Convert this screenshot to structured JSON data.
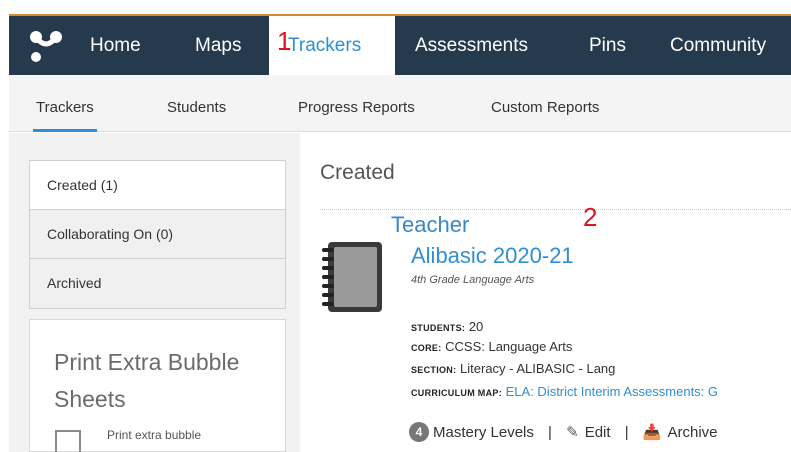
{
  "nav": {
    "items": [
      {
        "label": "Home"
      },
      {
        "label": "Maps"
      },
      {
        "label": "Trackers"
      },
      {
        "label": "Assessments"
      },
      {
        "label": "Pins"
      },
      {
        "label": "Community"
      }
    ],
    "marker_1": "1"
  },
  "subnav": {
    "items": [
      {
        "label": "Trackers"
      },
      {
        "label": "Students"
      },
      {
        "label": "Progress Reports"
      },
      {
        "label": "Custom Reports"
      }
    ]
  },
  "filters": [
    {
      "label": "Created (1)"
    },
    {
      "label": "Collaborating On (0)"
    },
    {
      "label": "Archived"
    }
  ],
  "bubble_card": {
    "title": "Print Extra Bubble Sheets",
    "text": "Print extra bubble"
  },
  "main": {
    "heading": "Created",
    "group_label": "Teacher",
    "marker_2": "2"
  },
  "tracker": {
    "title": "Alibasic 2020-21",
    "subtitle": "4th Grade Language Arts",
    "students_key": "Students:",
    "students_value": "20",
    "core_key": "Core:",
    "core_value": "CCSS: Language Arts",
    "section_key": "Section:",
    "section_value": "Literacy - ALIBASIC - Lang",
    "map_key": "Curriculum Map:",
    "map_value": "ELA: District Interim Assessments: G",
    "mastery_count": "4",
    "mastery_label": "Mastery Levels",
    "edit_label": "Edit",
    "archive_label": "Archive",
    "separator": "|"
  },
  "colors": {
    "nav_bg": "#263a4d",
    "accent": "#2e8fd3",
    "marker": "#e0141e"
  }
}
